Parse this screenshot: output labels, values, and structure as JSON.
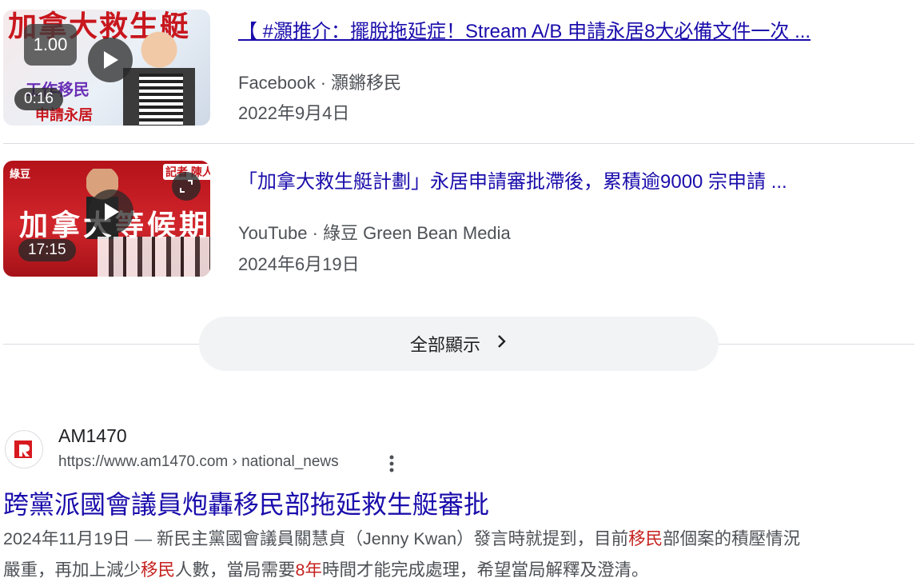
{
  "videos": [
    {
      "speed": "1.00",
      "duration": "0:16",
      "thumb_text": [
        "加拿大救生艇",
        "工作移民",
        "申請永居"
      ],
      "title": "【 #灝推介：擺脫拖延症！Stream A/B 申請永居8大必備文件一次 ...",
      "source": "Facebook · 灝鏘移民",
      "date": "2022年9月4日"
    },
    {
      "duration": "17:15",
      "thumb_text": [
        "加拿大等候期",
        "綠豆",
        "記者 陳人"
      ],
      "title": "「加拿大救生艇計劃」永居申請審批滯後，累積逾9000 宗申請 ...",
      "source": "YouTube · 綠豆 Green Bean Media",
      "date": "2024年6月19日"
    }
  ],
  "show_all": {
    "label": "全部顯示",
    "icon": "chevron-right-icon"
  },
  "result": {
    "site_name": "AM1470",
    "url": "https://www.am1470.com › national_news",
    "title": "跨黨派國會議員炮轟移民部拖延救生艇審批",
    "snippet_line1": [
      "2024年11月19日 — 新民主黨國會議員關慧貞（Jenny Kwan）發言時就提到，目前",
      "移民",
      "部個案的積壓情況"
    ],
    "snippet_line2": [
      "嚴重，再加上減少",
      "移民",
      "人數，當局需要",
      "8年",
      "時間才能完成處理，希望當局解釋及澄清。"
    ]
  },
  "colors": {
    "link": "#1a0dab",
    "meta": "#4d5156",
    "highlight": "#c5221f",
    "button_bg": "#f1f3f4"
  }
}
